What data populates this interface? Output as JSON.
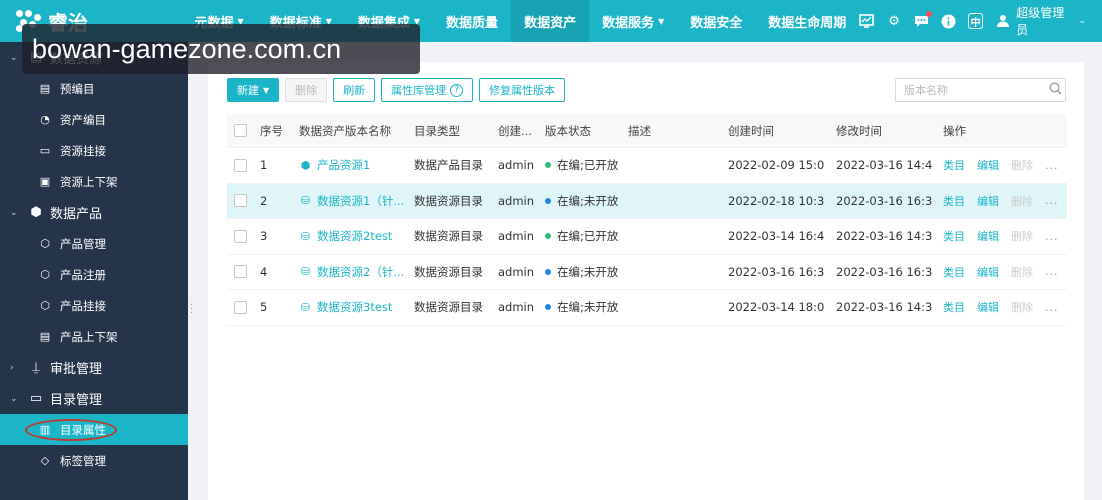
{
  "app": {
    "logo_text": "睿治"
  },
  "watermark": "bowan-gamezone.com.cn",
  "nav": [
    {
      "label": "元数据",
      "dropdown": true
    },
    {
      "label": "数据标准",
      "dropdown": true
    },
    {
      "label": "数据集成",
      "dropdown": true
    },
    {
      "label": "数据质量",
      "dropdown": false
    },
    {
      "label": "数据资产",
      "dropdown": false,
      "active": true
    },
    {
      "label": "数据服务",
      "dropdown": true
    },
    {
      "label": "数据安全",
      "dropdown": false
    },
    {
      "label": "数据生命周期",
      "dropdown": false
    }
  ],
  "top_tools": {
    "monitor_icon": "monitor-icon",
    "settings_icon": "gear-icon",
    "message_icon": "message-icon",
    "info_icon": "info-icon",
    "lang_label": "中",
    "user_name": "超级管理员"
  },
  "sidebar": {
    "groups": [
      {
        "label": "数据资源",
        "icon": "database-icon",
        "expanded": true,
        "items": [
          {
            "label": "预编目",
            "icon": "catalog-icon"
          },
          {
            "label": "资产编目",
            "icon": "asset-catalog-icon"
          },
          {
            "label": "资源挂接",
            "icon": "mount-icon"
          },
          {
            "label": "资源上下架",
            "icon": "shelf-icon"
          }
        ]
      },
      {
        "label": "数据产品",
        "icon": "cube-icon",
        "expanded": true,
        "items": [
          {
            "label": "产品管理",
            "icon": "product-manage-icon"
          },
          {
            "label": "产品注册",
            "icon": "product-register-icon"
          },
          {
            "label": "产品挂接",
            "icon": "product-mount-icon"
          },
          {
            "label": "产品上下架",
            "icon": "product-shelf-icon"
          }
        ]
      },
      {
        "label": "审批管理",
        "icon": "stamp-icon",
        "expanded": false,
        "items": []
      },
      {
        "label": "目录管理",
        "icon": "folder-icon",
        "expanded": true,
        "items": [
          {
            "label": "目录属性",
            "icon": "attribute-icon",
            "active": true
          },
          {
            "label": "标签管理",
            "icon": "tag-icon"
          }
        ]
      }
    ]
  },
  "toolbar": {
    "new_label": "新建",
    "delete_label": "删除",
    "refresh_label": "刷新",
    "attr_lib_label": "属性库管理",
    "restore_label": "修复属性版本"
  },
  "search": {
    "placeholder": "版本名称"
  },
  "table": {
    "headers": {
      "no": "序号",
      "name": "数据资产版本名称",
      "type": "目录类型",
      "creator": "创建...",
      "status": "版本状态",
      "desc": "描述",
      "ctime": "创建时间",
      "mtime": "修改时间",
      "ops": "操作"
    },
    "rows": [
      {
        "no": "1",
        "name": "产品资源1",
        "icon": "product-resource-icon",
        "type": "数据产品目录",
        "creator": "admin",
        "status": "在编;已开放",
        "status_color": "#2dbf6f",
        "desc": "",
        "ctime": "2022-02-09 15:0...",
        "mtime": "2022-03-16 14:4...",
        "highlight": false
      },
      {
        "no": "2",
        "name": "数据资源1（针...",
        "icon": "data-resource-icon",
        "type": "数据资源目录",
        "creator": "admin",
        "status": "在编;未开放",
        "status_color": "#1e88e5",
        "desc": "",
        "ctime": "2022-02-18 10:3...",
        "mtime": "2022-03-16 16:3...",
        "highlight": true
      },
      {
        "no": "3",
        "name": "数据资源2test",
        "icon": "data-resource-icon",
        "type": "数据资源目录",
        "creator": "admin",
        "status": "在编;已开放",
        "status_color": "#2dbf6f",
        "desc": "",
        "ctime": "2022-03-14 16:4...",
        "mtime": "2022-03-16 14:3...",
        "highlight": false
      },
      {
        "no": "4",
        "name": "数据资源2（针...",
        "icon": "data-resource-icon",
        "type": "数据资源目录",
        "creator": "admin",
        "status": "在编;未开放",
        "status_color": "#1e88e5",
        "desc": "",
        "ctime": "2022-03-16 16:3...",
        "mtime": "2022-03-16 16:3...",
        "highlight": false
      },
      {
        "no": "5",
        "name": "数据资源3test",
        "icon": "data-resource-icon",
        "type": "数据资源目录",
        "creator": "admin",
        "status": "在编;未开放",
        "status_color": "#1e88e5",
        "desc": "",
        "ctime": "2022-03-14 18:0...",
        "mtime": "2022-03-16 14:3...",
        "highlight": false
      }
    ],
    "ops": {
      "category": "类目",
      "edit": "编辑",
      "delete": "删除",
      "more": "..."
    }
  }
}
